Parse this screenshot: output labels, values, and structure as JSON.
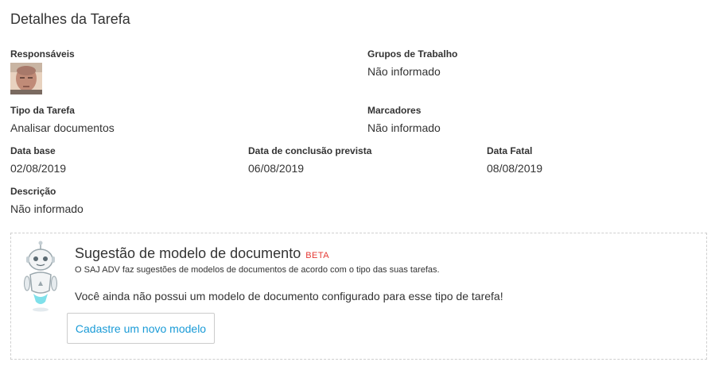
{
  "header": {
    "title": "Detalhes da Tarefa"
  },
  "fields": {
    "responsaveis": {
      "label": "Responsáveis"
    },
    "grupos": {
      "label": "Grupos de Trabalho",
      "value": "Não informado"
    },
    "tipo": {
      "label": "Tipo da Tarefa",
      "value": "Analisar documentos"
    },
    "marcadores": {
      "label": "Marcadores",
      "value": "Não informado"
    },
    "data_base": {
      "label": "Data base",
      "value": "02/08/2019"
    },
    "data_conclusao": {
      "label": "Data de conclusão prevista",
      "value": "06/08/2019"
    },
    "data_fatal": {
      "label": "Data Fatal",
      "value": "08/08/2019"
    },
    "descricao": {
      "label": "Descrição",
      "value": "Não informado"
    }
  },
  "suggestion": {
    "title": "Sugestão de modelo de documento",
    "badge": "BETA",
    "description": "O SAJ ADV faz sugestões de modelos de documentos de acordo com o tipo das suas tarefas.",
    "notice": "Você ainda não possui um modelo de documento configurado para esse tipo de tarefa!",
    "button_label": "Cadastre um novo modelo"
  },
  "colors": {
    "link": "#1a9bd7",
    "beta": "#e53935",
    "text": "#333333",
    "border": "#cfcfcf"
  },
  "icons": {
    "robot": "robot-mascot-icon",
    "avatar": "user-avatar"
  }
}
